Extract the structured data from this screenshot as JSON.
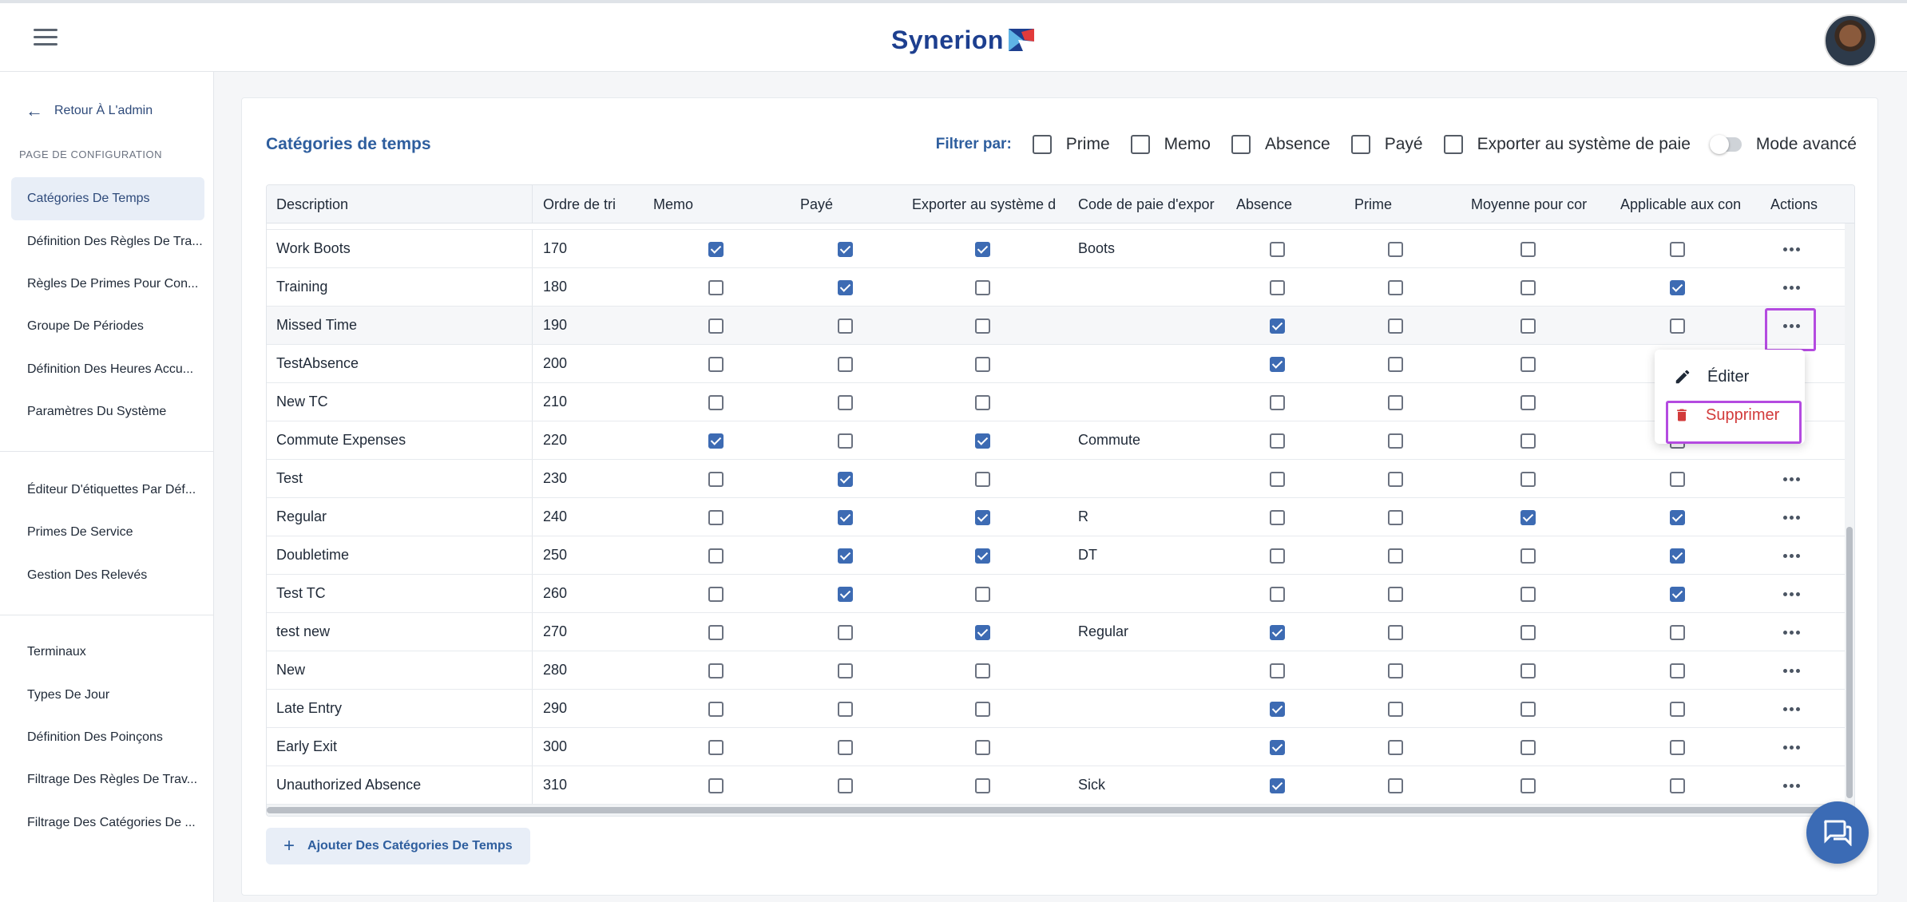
{
  "header": {
    "brand": "Synerion",
    "menu_icon": "hamburger-icon",
    "avatar_icon": "user-avatar"
  },
  "sidebar": {
    "back_label": "Retour À L'admin",
    "section_label": "PAGE DE CONFIGURATION",
    "group1": [
      "Catégories De Temps",
      "Définition Des Règles De Tra...",
      "Règles De Primes Pour Con...",
      "Groupe De Périodes",
      "Définition Des Heures Accu...",
      "Paramètres Du Système"
    ],
    "group2": [
      "Éditeur D'étiquettes Par Déf...",
      "Primes De Service",
      "Gestion Des Relevés"
    ],
    "group3": [
      "Terminaux",
      "Types De Jour",
      "Définition Des Poinçons",
      "Filtrage Des Règles De Trav...",
      "Filtrage Des Catégories De ..."
    ]
  },
  "panel": {
    "title": "Catégories de temps",
    "filter_label": "Filtrer par:",
    "filters": [
      "Prime",
      "Memo",
      "Absence",
      "Payé",
      "Exporter au système de paie"
    ],
    "advanced_mode": "Mode avancé",
    "add_button": "Ajouter Des Catégories De Temps"
  },
  "table": {
    "columns": [
      "Description",
      "Ordre de tri",
      "Memo",
      "Payé",
      "Exporter au système d",
      "Code de paie d'expor",
      "Absence",
      "Prime",
      "Moyenne pour cor",
      "Applicable aux con",
      "Actions"
    ],
    "rows": [
      {
        "description": "Work Boots",
        "order": "170",
        "memo": true,
        "paid": true,
        "export": true,
        "code": "Boots",
        "absence": false,
        "prime": false,
        "avg": false,
        "applicable": false
      },
      {
        "description": "Training",
        "order": "180",
        "memo": false,
        "paid": true,
        "export": false,
        "code": "",
        "absence": false,
        "prime": false,
        "avg": false,
        "applicable": true
      },
      {
        "description": "Missed Time",
        "order": "190",
        "memo": false,
        "paid": false,
        "export": false,
        "code": "",
        "absence": true,
        "prime": false,
        "avg": false,
        "applicable": false
      },
      {
        "description": "TestAbsence",
        "order": "200",
        "memo": false,
        "paid": false,
        "export": false,
        "code": "",
        "absence": true,
        "prime": false,
        "avg": false,
        "applicable": false
      },
      {
        "description": "New TC",
        "order": "210",
        "memo": false,
        "paid": false,
        "export": false,
        "code": "",
        "absence": false,
        "prime": false,
        "avg": false,
        "applicable": false
      },
      {
        "description": "Commute Expenses",
        "order": "220",
        "memo": true,
        "paid": false,
        "export": true,
        "code": "Commute",
        "absence": false,
        "prime": false,
        "avg": false,
        "applicable": false
      },
      {
        "description": "Test",
        "order": "230",
        "memo": false,
        "paid": true,
        "export": false,
        "code": "",
        "absence": false,
        "prime": false,
        "avg": false,
        "applicable": false
      },
      {
        "description": "Regular",
        "order": "240",
        "memo": false,
        "paid": true,
        "export": true,
        "code": "R",
        "absence": false,
        "prime": false,
        "avg": true,
        "applicable": true
      },
      {
        "description": "Doubletime",
        "order": "250",
        "memo": false,
        "paid": true,
        "export": true,
        "code": "DT",
        "absence": false,
        "prime": false,
        "avg": false,
        "applicable": true
      },
      {
        "description": "Test TC",
        "order": "260",
        "memo": false,
        "paid": true,
        "export": false,
        "code": "",
        "absence": false,
        "prime": false,
        "avg": false,
        "applicable": true
      },
      {
        "description": "test new",
        "order": "270",
        "memo": false,
        "paid": false,
        "export": true,
        "code": "Regular",
        "absence": true,
        "prime": false,
        "avg": false,
        "applicable": false
      },
      {
        "description": "New",
        "order": "280",
        "memo": false,
        "paid": false,
        "export": false,
        "code": "",
        "absence": false,
        "prime": false,
        "avg": false,
        "applicable": false
      },
      {
        "description": "Late Entry",
        "order": "290",
        "memo": false,
        "paid": false,
        "export": false,
        "code": "",
        "absence": true,
        "prime": false,
        "avg": false,
        "applicable": false
      },
      {
        "description": "Early Exit",
        "order": "300",
        "memo": false,
        "paid": false,
        "export": false,
        "code": "",
        "absence": true,
        "prime": false,
        "avg": false,
        "applicable": false
      },
      {
        "description": "Unauthorized Absence",
        "order": "310",
        "memo": false,
        "paid": false,
        "export": false,
        "code": "Sick",
        "absence": true,
        "prime": false,
        "avg": false,
        "applicable": false
      }
    ]
  },
  "context_menu": {
    "edit": "Éditer",
    "delete": "Supprimer"
  },
  "colors": {
    "accent": "#3d6bb3",
    "title": "#2e5e9e",
    "danger": "#d23b3b",
    "highlight": "#b44be0"
  }
}
